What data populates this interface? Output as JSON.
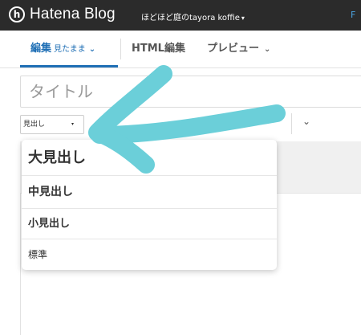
{
  "topbar": {
    "brand": "Hatena Blog",
    "logo_glyph": "h",
    "blog_name": "ほどほど庭のtayora koffie",
    "blog_caret": "▾",
    "right_fragment": "F"
  },
  "tabs": {
    "edit_label": "編集",
    "edit_sub": "見たまま",
    "html_label": "HTML編集",
    "preview_label": "プレビュー",
    "chevron": "⌄"
  },
  "title": {
    "placeholder": "タイトル"
  },
  "toolbar": {
    "style_select_value": "見出し",
    "style_select_dot": "▾",
    "icon_a": "☰",
    "icon_b": "⇇",
    "more_chevron": "⌄"
  },
  "heading_menu": {
    "items": [
      {
        "label": "大見出し"
      },
      {
        "label": "中見出し"
      },
      {
        "label": "小見出し"
      },
      {
        "label": "標準"
      }
    ]
  },
  "annotation": {
    "arrow_color": "#6bcfd9"
  },
  "colors": {
    "topbar_bg": "#2b2b2b",
    "accent": "#1f6fb5"
  }
}
